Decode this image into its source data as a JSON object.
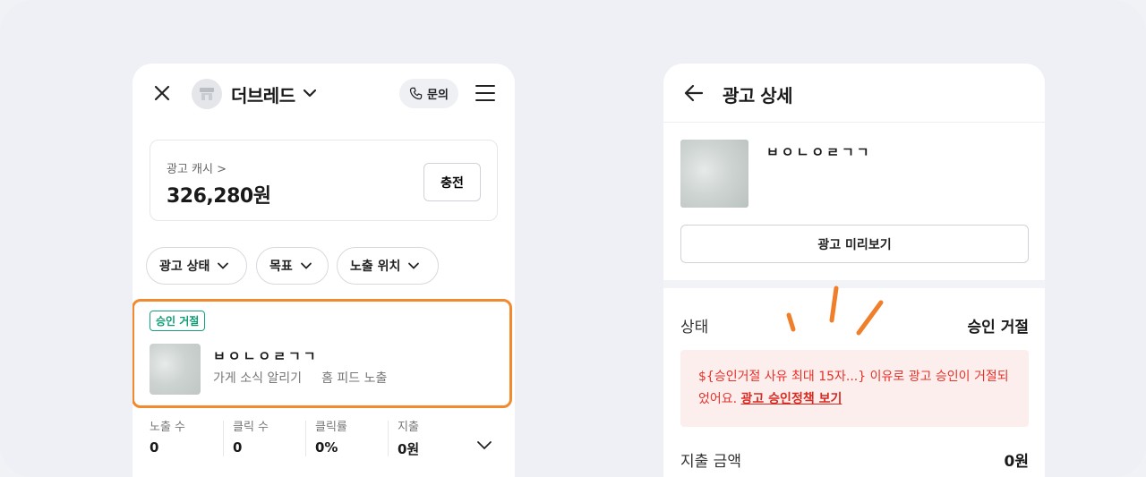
{
  "left_phone": {
    "header": {
      "store_name": "더브레드",
      "inquiry_label": "문의"
    },
    "cash": {
      "label": "광고 캐시 >",
      "amount": "326,280원",
      "charge_label": "충전"
    },
    "filters": [
      {
        "label": "광고 상태"
      },
      {
        "label": "목표"
      },
      {
        "label": "노출 위치"
      }
    ],
    "ad_item": {
      "badge": "승인 거절",
      "title": "ㅂㅇㄴㅇㄹㄱㄱ",
      "goal": "가게 소식 알리기",
      "placement": "홈 피드 노출"
    },
    "stats": [
      {
        "label": "노출 수",
        "value": "0"
      },
      {
        "label": "클릭 수",
        "value": "0"
      },
      {
        "label": "클릭률",
        "value": "0%"
      },
      {
        "label": "지출",
        "value": "0원"
      }
    ]
  },
  "right_phone": {
    "header": {
      "title": "광고 상세"
    },
    "ad": {
      "title": "ㅂㅇㄴㅇㄹㄱㄱ",
      "preview_label": "광고 미리보기"
    },
    "status": {
      "label": "상태",
      "value": "승인 거절"
    },
    "reject_notice": {
      "message": "${승인거절 사유 최대 15자...} 이유로 광고 승인이 거절되었어요.",
      "link_label": "광고 승인정책 보기"
    },
    "spend": {
      "label": "지출 금액",
      "value": "0원"
    }
  },
  "colors": {
    "highlight_border": "#f18a2f",
    "badge_green": "#0e9b74",
    "error_red": "#e5332a",
    "error_bg": "#fdeeee",
    "spark_orange": "#ef7f2a"
  }
}
